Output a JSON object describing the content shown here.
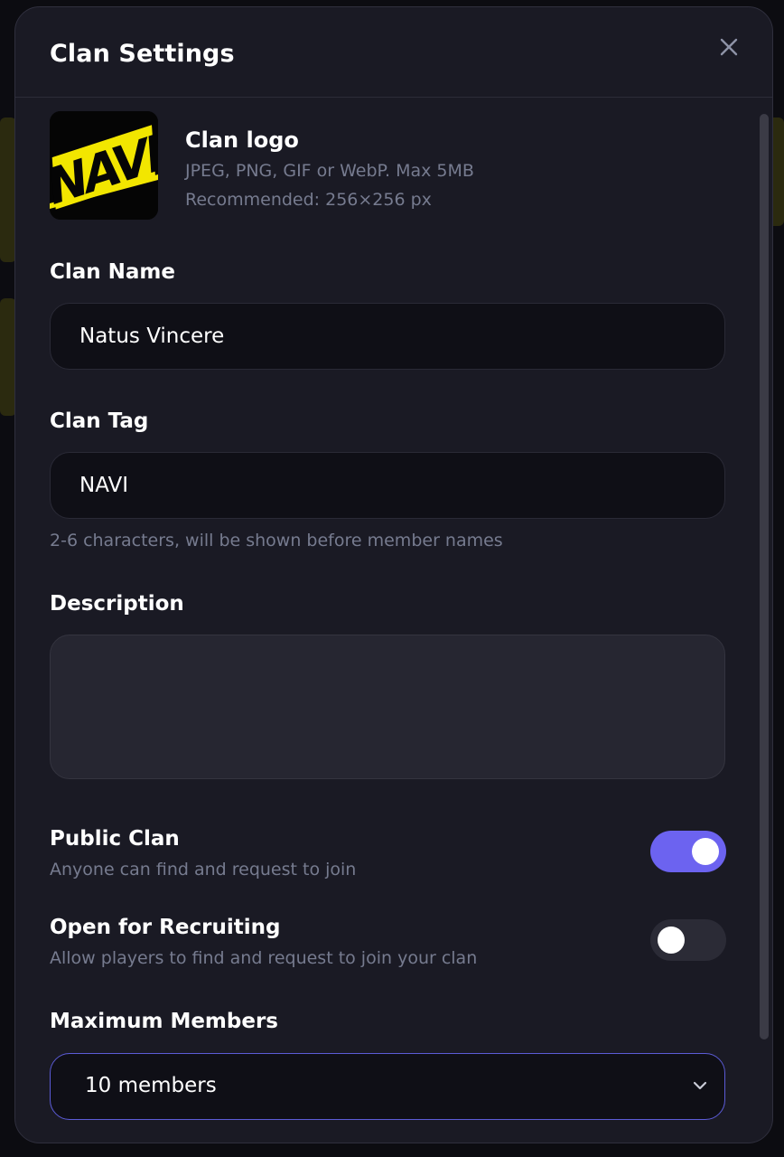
{
  "modal": {
    "title": "Clan Settings",
    "close_icon": "close-icon"
  },
  "logo": {
    "title": "Clan logo",
    "formats": "JPEG, PNG, GIF or WebP. Max 5MB",
    "recommended": "Recommended: 256×256 px",
    "image_text": "NAVI"
  },
  "clan_name": {
    "label": "Clan Name",
    "value": "Natus Vincere"
  },
  "clan_tag": {
    "label": "Clan Tag",
    "value": "NAVI",
    "hint": "2-6 characters, will be shown before member names"
  },
  "description": {
    "label": "Description",
    "value": ""
  },
  "public_clan": {
    "title": "Public Clan",
    "subtitle": "Anyone can find and request to join",
    "enabled": true
  },
  "recruiting": {
    "title": "Open for Recruiting",
    "subtitle": "Allow players to find and request to join your clan",
    "enabled": false
  },
  "max_members": {
    "label": "Maximum Members",
    "value": "10 members",
    "icon": "chevron-down-icon"
  },
  "colors": {
    "accent": "#6c63f0",
    "modal_bg": "#1a1a24",
    "muted_text": "#767b8f",
    "logo_yellow": "#f2e600"
  }
}
